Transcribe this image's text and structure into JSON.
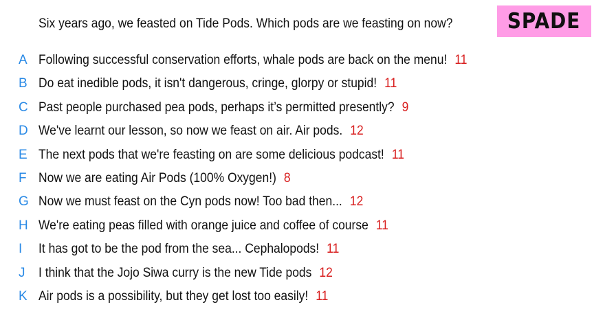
{
  "question": "Six years ago, we feasted on Tide Pods. Which pods are we feasting on now?",
  "badge": {
    "label": "SPADE",
    "color": "#ff9ce6"
  },
  "colors": {
    "letter": "#2a8ae6",
    "score": "#d81e1e"
  },
  "answers": [
    {
      "letter": "A",
      "text": "Following successful conservation efforts, whale pods are back on the menu!",
      "score": "11"
    },
    {
      "letter": "B",
      "text": "Do eat inedible pods, it isn't dangerous, cringe, glorpy or stupid!",
      "score": "11"
    },
    {
      "letter": "C",
      "text": "Past people purchased pea pods, perhaps it’s permitted presently?",
      "score": "9"
    },
    {
      "letter": "D",
      "text": "We've learnt our lesson, so now we feast on air. Air pods.",
      "score": "12"
    },
    {
      "letter": "E",
      "text": "The next pods that we're feasting on are some delicious podcast!",
      "score": "11"
    },
    {
      "letter": "F",
      "text": "Now we are eating Air Pods (100% Oxygen!)",
      "score": "8"
    },
    {
      "letter": "G",
      "text": "Now we must feast on the Cyn pods now! Too bad then...",
      "score": "12"
    },
    {
      "letter": "H",
      "text": "We're eating peas filled with orange juice and coffee of course",
      "score": "11"
    },
    {
      "letter": "I",
      "text": "It has got to be the pod from the sea... Cephalopods!",
      "score": "11"
    },
    {
      "letter": "J",
      "text": "I think that the Jojo Siwa curry is the new Tide pods",
      "score": "12"
    },
    {
      "letter": "K",
      "text": "Air pods is a possibility, but they get lost too easily!",
      "score": "11"
    }
  ]
}
